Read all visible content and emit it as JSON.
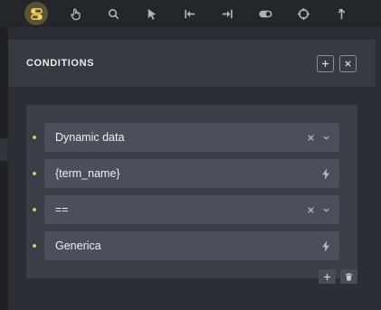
{
  "toolbar": {
    "icons": [
      "conditions-icon",
      "pointer-hand-icon",
      "search-icon",
      "cursor-arrow-icon",
      "step-backward-icon",
      "step-forward-icon",
      "toggle-icon",
      "target-icon",
      "arrow-up-icon"
    ],
    "active_color": "#f3d36a"
  },
  "panel": {
    "title": "CONDITIONS"
  },
  "conditions": {
    "rows": [
      {
        "value": "Dynamic data",
        "actions": [
          "clear",
          "dropdown"
        ]
      },
      {
        "value": "{term_name}",
        "actions": [
          "dynamic"
        ]
      },
      {
        "value": "==",
        "actions": [
          "clear",
          "dropdown"
        ]
      },
      {
        "value": "Generica",
        "actions": [
          "dynamic"
        ]
      }
    ]
  },
  "colors": {
    "accent": "#e2c04f",
    "background": "#2a2d33",
    "field": "#4a4f59"
  }
}
